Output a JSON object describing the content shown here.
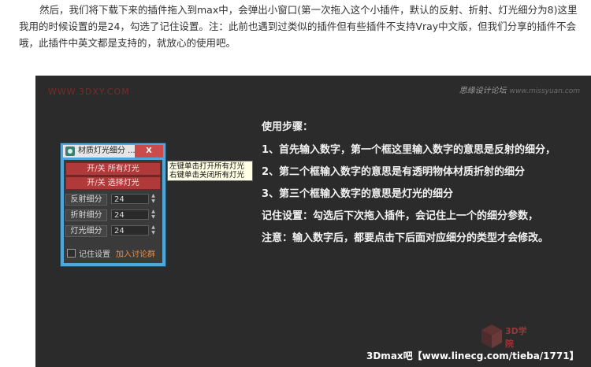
{
  "article": {
    "paragraph": "然后，我们将下载下来的插件拖入到max中，会弹出小窗口(第一次拖入这个小插件，默认的反射、折射、灯光细分为8)这里我用的时候设置的是24，勾选了记住设置。注：此前也遇到过类似的插件但有些插件不支持Vray中文版，但我们分享的插件不会哦，此插件中英文都是支持的，就放心的使用吧。"
  },
  "screenshot": {
    "watermark_left": "WWW.3DXY.COM",
    "watermark_right": "思缘设计论坛",
    "watermark_right_url": "www.missyuan.com",
    "plugin": {
      "title": "材质灯光细分 ...",
      "close_label": "X",
      "btn_all_lights": "开/关 所有灯光",
      "btn_selected_lights": "开/关 选择灯光",
      "rows": [
        {
          "label": "反射细分",
          "value": "24"
        },
        {
          "label": "折射细分",
          "value": "24"
        },
        {
          "label": "灯光细分",
          "value": "24"
        }
      ],
      "remember_label": "记住设置",
      "discuss_label": "加入讨论群"
    },
    "tooltip": {
      "line1": "左键单击打开所有灯光",
      "line2": "右键单击关闭所有灯光"
    },
    "steps": {
      "heading": "使用步骤：",
      "step1": "1、首先输入数字，第一个框这里输入数字的意思是反射的细分，",
      "step2": "2、第二个框输入数字的意思是有透明物体材质折射的细分",
      "step3": "3、第三个框输入数字的意思是灯光的细分",
      "remember_note": "记住设置：勾选后下次拖入插件，会记住上一个的细分参数，",
      "attention_note": "注意：输入数字后，都要点击下后面对应细分的类型才会修改。"
    },
    "footer": "3Dmax吧【www.linecg.com/tieba/1771】",
    "logo_text": "3D学院"
  },
  "colors": {
    "background_dark": "#2b2b2b",
    "plugin_frame": "#4fa6d9",
    "toggle_button": "#b03a3a",
    "close_button": "#c94b4b",
    "discuss_link": "#f08c3a"
  }
}
